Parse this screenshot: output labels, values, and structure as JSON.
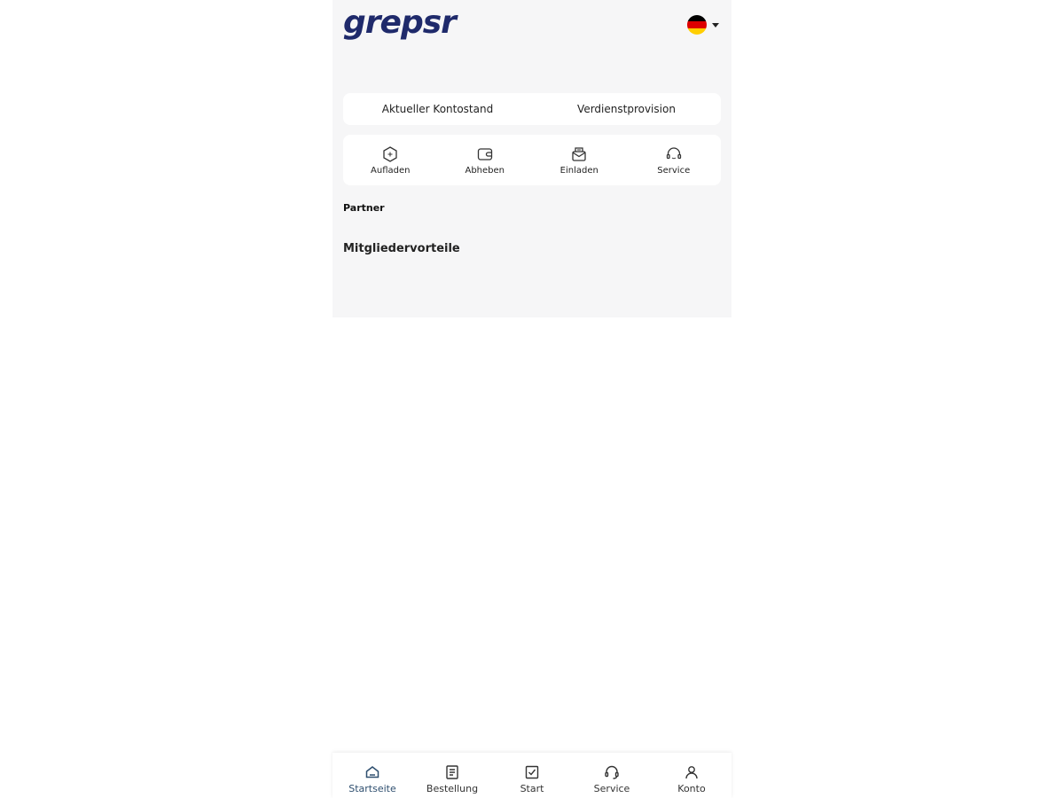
{
  "header": {
    "logo_text": "grepsr",
    "language": "de",
    "flag_colors": [
      "#000000",
      "#dd0000",
      "#ffce00"
    ]
  },
  "balance": {
    "current_balance_label": "Aktueller Kontostand",
    "commission_label": "Verdienstprovision"
  },
  "actions": [
    {
      "label": "Aufladen",
      "icon": "recharge-icon"
    },
    {
      "label": "Abheben",
      "icon": "wallet-icon"
    },
    {
      "label": "Einladen",
      "icon": "invite-mail-icon"
    },
    {
      "label": "Service",
      "icon": "headset-icon"
    }
  ],
  "sections": {
    "partner": "Partner",
    "benefits": "Mitgliedervorteile"
  },
  "bottom_nav": {
    "items": [
      {
        "label": "Startseite",
        "icon": "home-icon",
        "active": true
      },
      {
        "label": "Bestellung",
        "icon": "order-icon",
        "active": false
      },
      {
        "label": "Start",
        "icon": "checkbox-icon",
        "active": false
      },
      {
        "label": "Service",
        "icon": "headset-icon",
        "active": false
      },
      {
        "label": "Konto",
        "icon": "user-icon",
        "active": false
      }
    ]
  },
  "colors": {
    "brand": "#1f2a6b",
    "active_nav": "#2f4f6f",
    "background": "#f6f6f7"
  }
}
